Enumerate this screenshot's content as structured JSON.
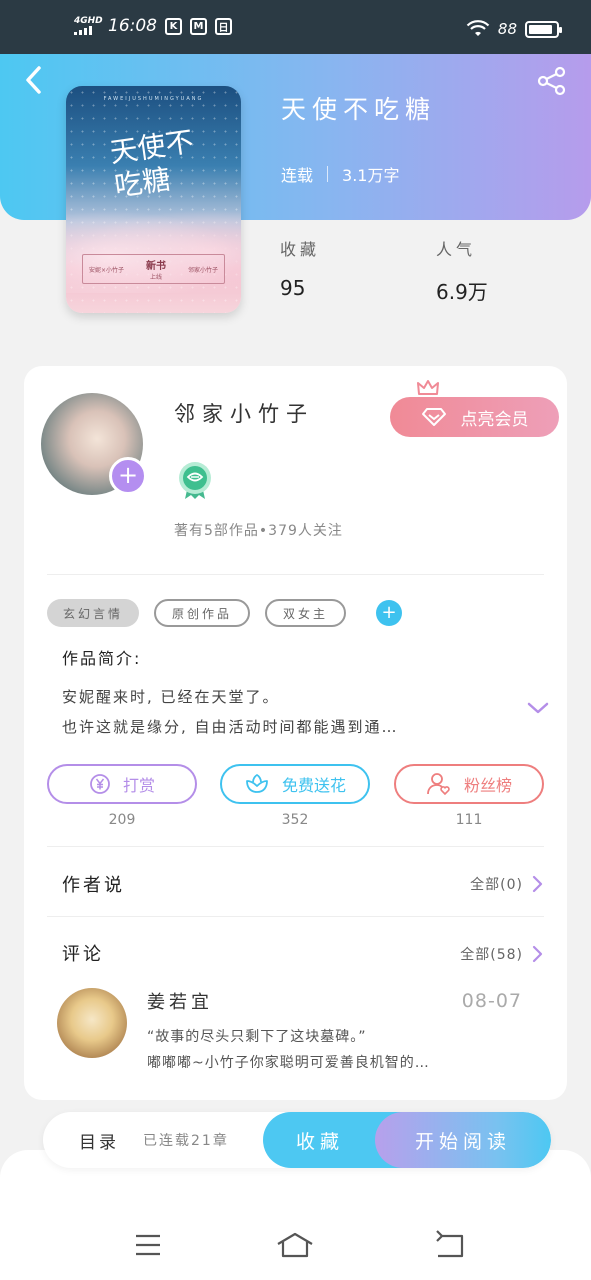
{
  "status_bar": {
    "network": "4GHD",
    "time": "16:08",
    "app_icons": [
      "K",
      "M",
      "日"
    ],
    "battery": "88",
    "battery_level": 0.88
  },
  "book": {
    "title": "天使不吃糖",
    "status": "连载",
    "word_count": "3.1万字",
    "cover": {
      "top_text": "FAWEIJUSHUMINGYUANG",
      "title": "天使不吃糖",
      "box_left": "安妮×小竹子",
      "box_center": "新书",
      "box_center_sub": "上线",
      "box_right": "邻家小竹子"
    },
    "stats": [
      {
        "label": "收藏",
        "value": "95"
      },
      {
        "label": "人气",
        "value": "6.9万"
      }
    ]
  },
  "author": {
    "name": "邻家小竹子",
    "vip_button": "点亮会员",
    "stats_text": "著有5部作品•379人关注"
  },
  "tags": [
    "玄幻言情",
    "原创作品",
    "双女主"
  ],
  "intro": {
    "title": "作品简介:",
    "line1": "安妮醒来时, 已经在天堂了。",
    "line2": "也许这就是缘分, 自由活动时间都能遇到通…"
  },
  "actions": [
    {
      "label": "打赏",
      "count": "209",
      "icon": "yen-icon",
      "color": "#b48ee8"
    },
    {
      "label": "免费送花",
      "count": "352",
      "icon": "flower-icon",
      "color": "#3ec2ef"
    },
    {
      "label": "粉丝榜",
      "count": "111",
      "icon": "fan-icon",
      "color": "#ee7e7e"
    }
  ],
  "author_says": {
    "title": "作者说",
    "all": "全部(0)"
  },
  "comments": {
    "title": "评论",
    "all": "全部(58)",
    "items": [
      {
        "user": "姜若宜",
        "date": "08-07",
        "quote": "“故事的尽头只剩下了这块墓碑。”",
        "text": "嘟嘟嘟~小竹子你家聪明可爱善良机智的…"
      }
    ]
  },
  "bottom_bar": {
    "toc": "目录",
    "chapters": "已连载21章",
    "favorite": "收藏",
    "read": "开始阅读"
  },
  "colors": {
    "accent_blue": "#4dc8f2",
    "accent_purple": "#b48ef0",
    "vip_pink": "#f08a96"
  }
}
